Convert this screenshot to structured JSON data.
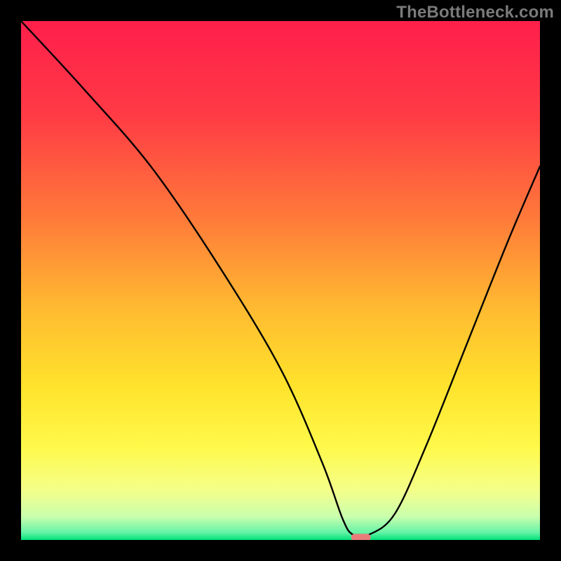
{
  "watermark": "TheBottleneck.com",
  "chart_data": {
    "type": "line",
    "title": "",
    "xlabel": "",
    "ylabel": "",
    "xlim": [
      0,
      100
    ],
    "ylim": [
      0,
      100
    ],
    "x": [
      0,
      12,
      25,
      38,
      50,
      58,
      62,
      64,
      67,
      72,
      78,
      86,
      94,
      100
    ],
    "values": [
      100,
      87,
      72,
      53,
      33,
      15,
      4,
      1,
      1,
      5,
      18,
      38,
      58,
      72
    ],
    "marker": {
      "x": 65.5,
      "y": 0.5
    },
    "gradient_stops": [
      {
        "offset": 0.0,
        "color": "#ff1f4b"
      },
      {
        "offset": 0.18,
        "color": "#ff3a45"
      },
      {
        "offset": 0.38,
        "color": "#ff7a3a"
      },
      {
        "offset": 0.55,
        "color": "#ffb931"
      },
      {
        "offset": 0.7,
        "color": "#ffe22b"
      },
      {
        "offset": 0.82,
        "color": "#fff94a"
      },
      {
        "offset": 0.905,
        "color": "#f4ff8a"
      },
      {
        "offset": 0.955,
        "color": "#c9ffad"
      },
      {
        "offset": 0.985,
        "color": "#68f3a7"
      },
      {
        "offset": 1.0,
        "color": "#00e27a"
      }
    ],
    "marker_color": "#e87d7c"
  }
}
